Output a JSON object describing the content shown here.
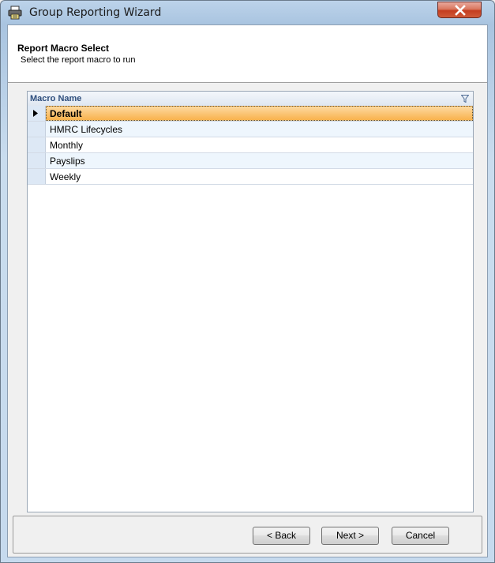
{
  "window": {
    "title": "Group Reporting Wizard"
  },
  "header": {
    "title": "Report Macro Select",
    "subtitle": "Select the report macro to run"
  },
  "grid": {
    "column_header": "Macro Name",
    "rows": [
      {
        "name": "Default",
        "selected": true
      },
      {
        "name": "HMRC Lifecycles",
        "selected": false
      },
      {
        "name": "Monthly",
        "selected": false
      },
      {
        "name": "Payslips",
        "selected": false
      },
      {
        "name": "Weekly",
        "selected": false
      }
    ]
  },
  "buttons": {
    "back": "< Back",
    "next": "Next >",
    "cancel": "Cancel"
  },
  "colors": {
    "selected_row": "#f9b24d",
    "close_button": "#c43d1f",
    "title_bar": "#bcd3ea"
  }
}
